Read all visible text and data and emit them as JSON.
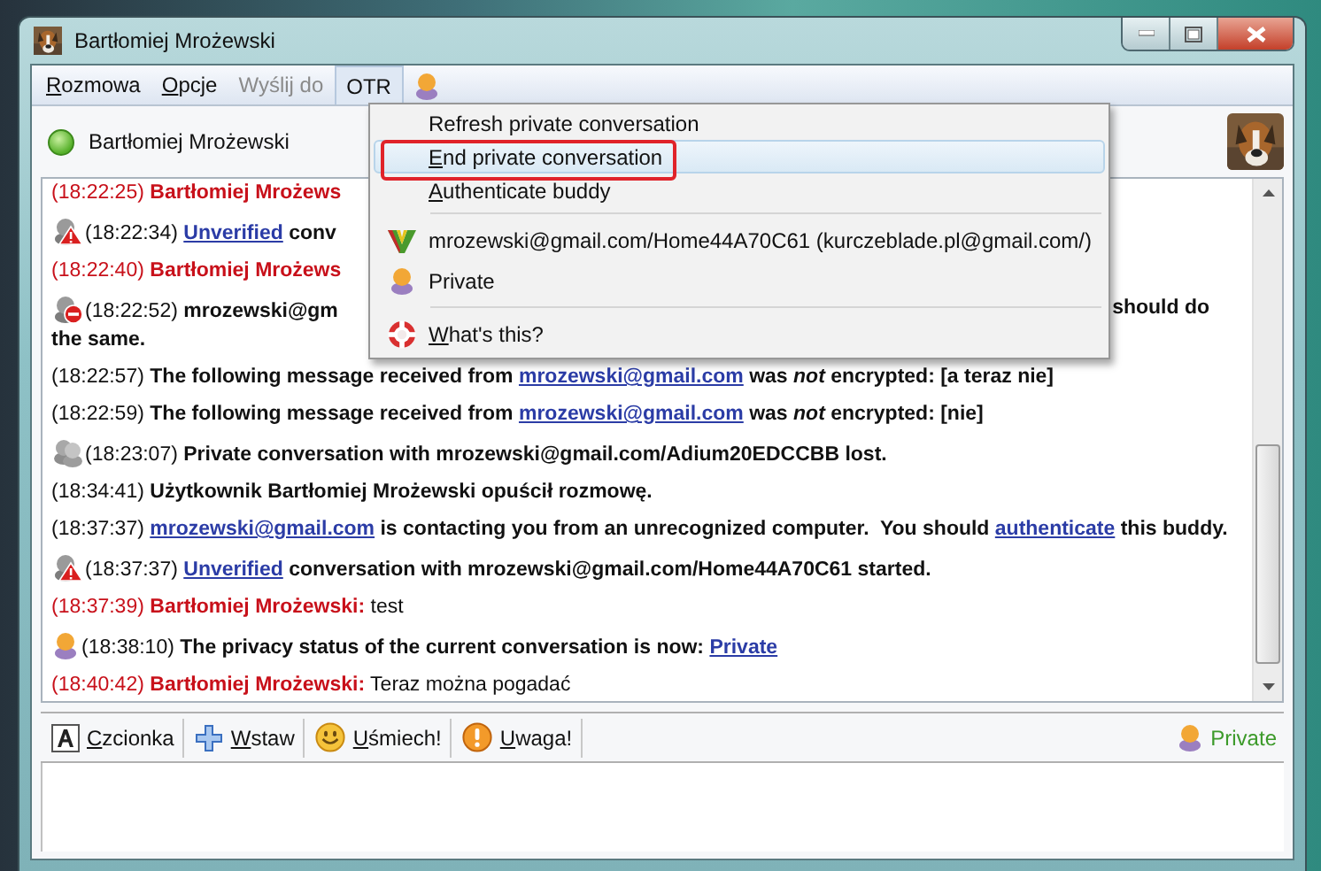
{
  "window": {
    "title": "Bartłomiej Mrożewski"
  },
  "menubar": [
    {
      "label": "Rozmowa",
      "underline_first": true,
      "disabled": false,
      "selected": false
    },
    {
      "label": "Opcje",
      "underline_first": true,
      "disabled": false,
      "selected": false
    },
    {
      "label": "Wyślij do",
      "underline_first": false,
      "disabled": true,
      "selected": false
    },
    {
      "label": "OTR",
      "underline_first": false,
      "disabled": false,
      "selected": true
    }
  ],
  "buddy": {
    "name": "Bartłomiej Mrożewski",
    "online": true
  },
  "otr_menu": {
    "groups": [
      [
        {
          "label": "Refresh private conversation",
          "underline_first": false,
          "selected": false
        },
        {
          "label": "End private conversation",
          "underline_first": true,
          "selected": true
        },
        {
          "label": "Authenticate buddy",
          "underline_first": true,
          "selected": false
        }
      ],
      [
        {
          "label": "mrozewski@gmail.com/Home44A70C61 (kurczeblade.pl@gmail.com/)",
          "underline_first": false,
          "selected": false,
          "kind": "account"
        },
        {
          "label": "Private",
          "underline_first": false,
          "selected": false,
          "kind": "private"
        }
      ],
      [
        {
          "label": "What's this?",
          "underline_first": true,
          "selected": false,
          "kind": "help"
        }
      ]
    ]
  },
  "log": [
    {
      "kind": "incoming",
      "parts": [
        {
          "kind": "time",
          "text": "(18:22:25)"
        },
        {
          "kind": "name",
          "text": "Bartłomiej Mrożews"
        }
      ]
    },
    {
      "kind": "unverified",
      "parts": [
        {
          "kind": "time",
          "text": "(18:22:34)"
        },
        {
          "kind": "link",
          "text": "Unverified"
        },
        {
          "kind": "bold",
          "text": " conv"
        }
      ]
    },
    {
      "kind": "incoming",
      "parts": [
        {
          "kind": "time",
          "text": "(18:22:40)"
        },
        {
          "kind": "name",
          "text": "Bartłomiej Mrożews"
        }
      ]
    },
    {
      "kind": "ended",
      "parts": [
        {
          "kind": "time",
          "text": "(18:22:52)"
        },
        {
          "kind": "bold",
          "text": "mrozewski@gm"
        }
      ],
      "right": "should do",
      "continuation": "the same."
    },
    {
      "kind": "system",
      "parts": [
        {
          "kind": "time",
          "text": "(18:22:57)"
        },
        {
          "kind": "bold",
          "text": "The following message received from "
        },
        {
          "kind": "link",
          "text": "mrozewski@gmail.com"
        },
        {
          "kind": "bold",
          "text": " was "
        },
        {
          "kind": "italic",
          "text": "not"
        },
        {
          "kind": "bold",
          "text": " encrypted: [a teraz nie]"
        }
      ]
    },
    {
      "kind": "system",
      "parts": [
        {
          "kind": "time",
          "text": "(18:22:59)"
        },
        {
          "kind": "bold",
          "text": "The following message received from "
        },
        {
          "kind": "link",
          "text": "mrozewski@gmail.com"
        },
        {
          "kind": "bold",
          "text": " was "
        },
        {
          "kind": "italic",
          "text": "not"
        },
        {
          "kind": "bold",
          "text": " encrypted: [nie]"
        }
      ]
    },
    {
      "kind": "lost",
      "parts": [
        {
          "kind": "time",
          "text": "(18:23:07)"
        },
        {
          "kind": "bold",
          "text": "Private conversation with mrozewski@gmail.com/Adium20EDCCBB lost."
        }
      ]
    },
    {
      "kind": "system",
      "parts": [
        {
          "kind": "time",
          "text": "(18:34:41)"
        },
        {
          "kind": "bold",
          "text": "Użytkownik Bartłomiej Mrożewski opuścił rozmowę."
        }
      ]
    },
    {
      "kind": "system",
      "parts": [
        {
          "kind": "time",
          "text": "(18:37:37)"
        },
        {
          "kind": "link",
          "text": "mrozewski@gmail.com"
        },
        {
          "kind": "bold",
          "text": " is contacting you from an unrecognized computer.  You should "
        },
        {
          "kind": "link",
          "text": "authenticate"
        },
        {
          "kind": "bold",
          "text": " this buddy."
        }
      ]
    },
    {
      "kind": "unverified",
      "parts": [
        {
          "kind": "time",
          "text": "(18:37:37)"
        },
        {
          "kind": "link",
          "text": "Unverified"
        },
        {
          "kind": "bold",
          "text": " conversation with mrozewski@gmail.com/Home44A70C61 started."
        }
      ]
    },
    {
      "kind": "incoming",
      "parts": [
        {
          "kind": "time",
          "text": "(18:37:39)"
        },
        {
          "kind": "name",
          "text": "Bartłomiej Mrożewski:"
        },
        {
          "kind": "text",
          "text": " test"
        }
      ]
    },
    {
      "kind": "private",
      "parts": [
        {
          "kind": "time",
          "text": "(18:38:10)"
        },
        {
          "kind": "bold",
          "text": "The privacy status of the current conversation is now: "
        },
        {
          "kind": "link",
          "text": "Private"
        }
      ]
    },
    {
      "kind": "incoming",
      "parts": [
        {
          "kind": "time",
          "text": "(18:40:42)"
        },
        {
          "kind": "name",
          "text": "Bartłomiej Mrożewski:"
        },
        {
          "kind": "text",
          "text": " Teraz można pogadać"
        }
      ]
    }
  ],
  "toolbar": [
    {
      "label": "Czcionka",
      "kind": "font",
      "underline_first": true
    },
    {
      "label": "Wstaw",
      "kind": "insert",
      "underline_first": true
    },
    {
      "label": "Uśmiech!",
      "kind": "smiley",
      "underline_first": true
    },
    {
      "label": "Uwaga!",
      "kind": "attention",
      "underline_first": true
    }
  ],
  "privacy_status": {
    "label": "Private",
    "kind": "private"
  }
}
